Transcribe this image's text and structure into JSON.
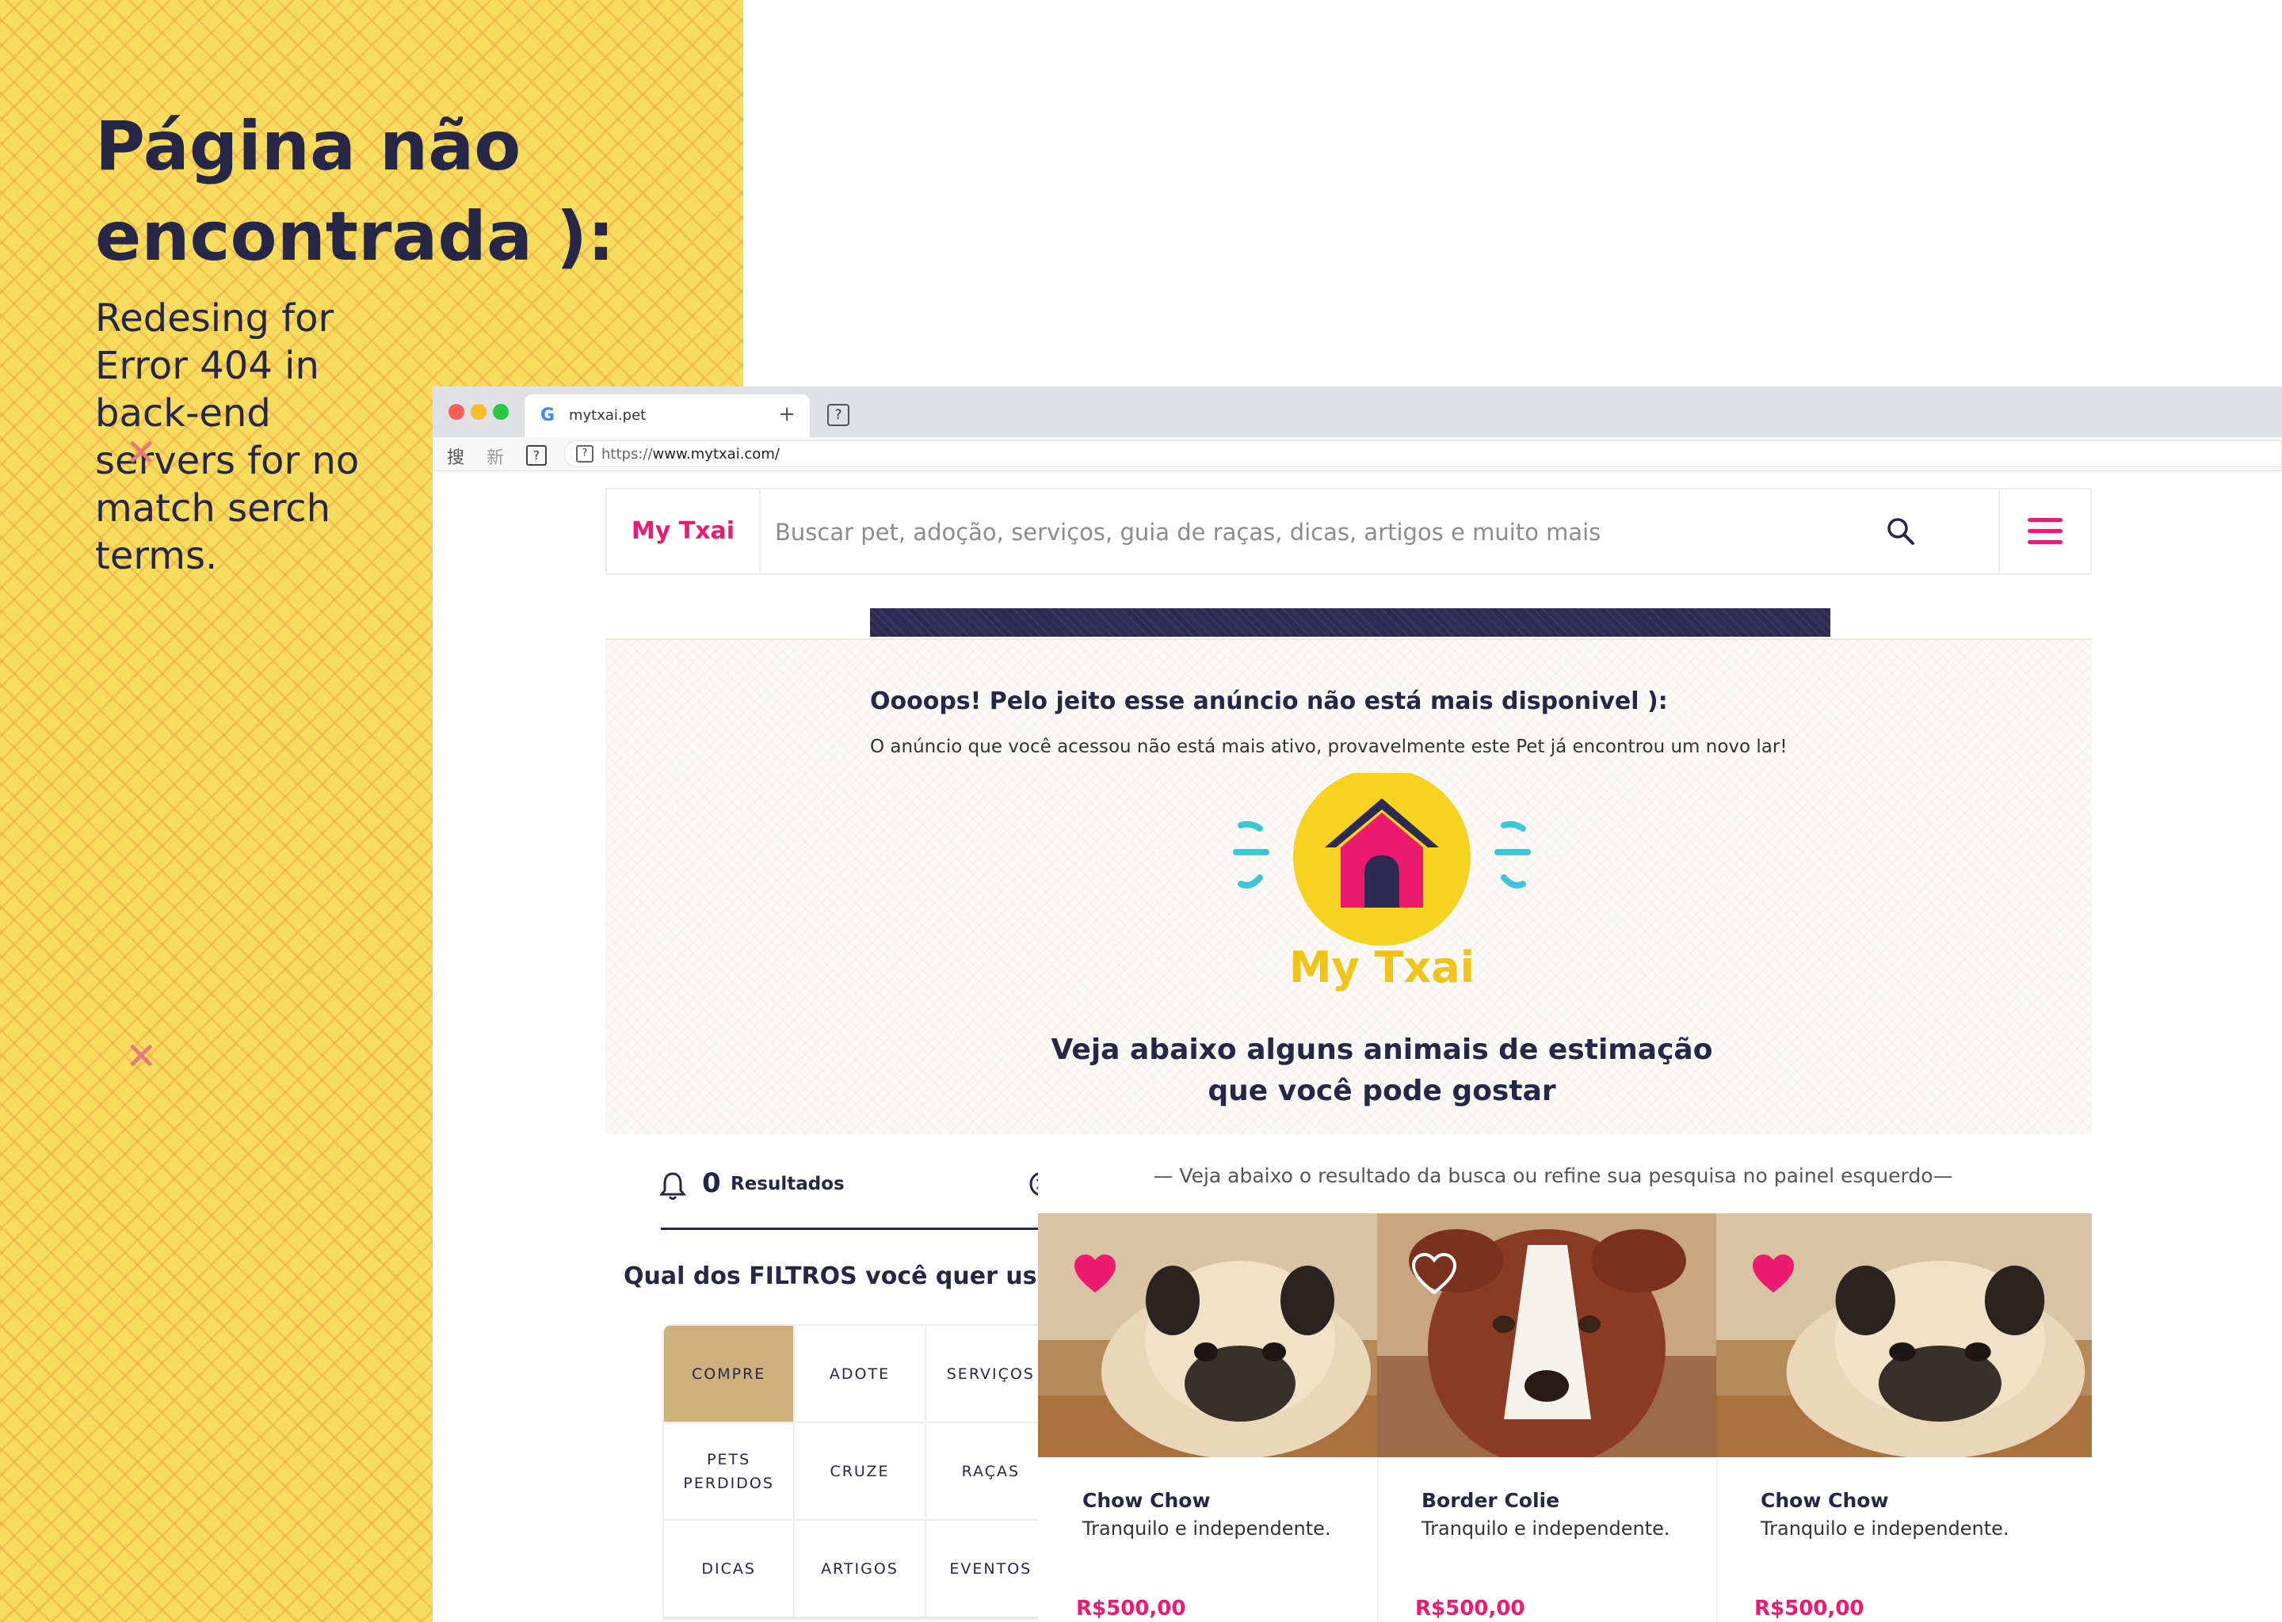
{
  "poster": {
    "title": "Página não encontrada ):",
    "subtitle": "Redesing for Error 404 in back-end servers for no match serch terms."
  },
  "browser": {
    "tab_title": "mytxai.pet",
    "tab_new": "+",
    "url_scheme": "https://",
    "url_host": "www.mytxai.com/"
  },
  "header": {
    "logo": "My Txai",
    "search_placeholder": "Buscar pet, adoção, serviços, guia de raças, dicas, artigos e muito mais"
  },
  "notice": {
    "title": "Oooops! Pelo jeito esse anúncio não está mais disponivel ):",
    "text": "O anúncio que você acessou não está mais ativo, provavelmente este Pet já encontrou um novo lar!",
    "brand": "My Txai",
    "suggest_line1": "Veja abaixo alguns animais de estimação",
    "suggest_line2": "que você pode gostar"
  },
  "filters": {
    "results_count": "0",
    "results_label": "Resultados",
    "question": "Qual dos FILTROS você quer usar?",
    "items": [
      {
        "label": "COMPRE",
        "active": true
      },
      {
        "label": "ADOTE",
        "active": false
      },
      {
        "label": "SERVIÇOS",
        "active": false
      },
      {
        "label": "PETS PERDIDOS",
        "active": false
      },
      {
        "label": "CRUZE",
        "active": false
      },
      {
        "label": "RAÇAS",
        "active": false
      },
      {
        "label": "DICAS",
        "active": false
      },
      {
        "label": "ARTIGOS",
        "active": false
      },
      {
        "label": "EVENTOS",
        "active": false
      }
    ]
  },
  "results": {
    "hint": "— Veja abaixo o resultado da busca ou refine sua pesquisa no painel esquerdo—",
    "cards": [
      {
        "name": "Chow Chow",
        "desc": "Tranquilo e independente.",
        "price": "R$500,00",
        "favorite": true
      },
      {
        "name": "Border Colie",
        "desc": "Tranquilo e independente.",
        "price": "R$500,00",
        "favorite": false
      },
      {
        "name": "Chow Chow",
        "desc": "Tranquilo e independente.",
        "price": "R$500,00",
        "favorite": true
      }
    ]
  },
  "colors": {
    "brand_pink": "#ec1b6f",
    "navy": "#262747",
    "poster_yellow": "#f7dd5e",
    "logo_yellow": "#f0c419",
    "filter_active": "#cdb07c"
  }
}
